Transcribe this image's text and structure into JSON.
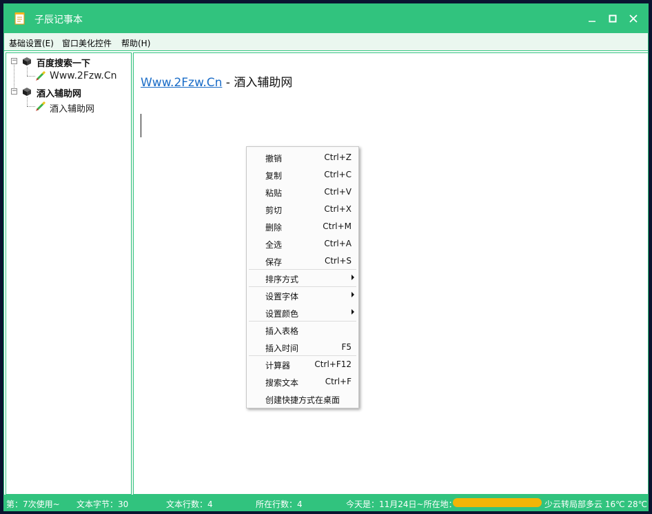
{
  "window": {
    "title": "子辰记事本"
  },
  "menubar": {
    "items": [
      "基础设置(E)",
      "窗口美化控件",
      "帮助(H)"
    ]
  },
  "tree": {
    "nodes": [
      {
        "label": "百度搜索一下",
        "child": "Www.2Fzw.Cn"
      },
      {
        "label": "酒入辅助网",
        "child": "酒入辅助网"
      }
    ]
  },
  "editor": {
    "link_text": "Www.2Fzw.Cn",
    "separator": " - ",
    "suffix": "酒入辅助网"
  },
  "context_menu": {
    "items": [
      {
        "label": "撤销",
        "shortcut": "Ctrl+Z"
      },
      {
        "label": "复制",
        "shortcut": "Ctrl+C"
      },
      {
        "label": "粘贴",
        "shortcut": "Ctrl+V"
      },
      {
        "label": "剪切",
        "shortcut": "Ctrl+X"
      },
      {
        "label": "删除",
        "shortcut": "Ctrl+M"
      },
      {
        "label": "全选",
        "shortcut": "Ctrl+A"
      },
      {
        "label": "保存",
        "shortcut": "Ctrl+S"
      },
      {
        "label": "排序方式",
        "shortcut": ""
      },
      {
        "label": "设置字体",
        "shortcut": ""
      },
      {
        "label": "设置颜色",
        "shortcut": ""
      },
      {
        "label": "插入表格",
        "shortcut": ""
      },
      {
        "label": "插入时间",
        "shortcut": "F5"
      },
      {
        "label": "计算器",
        "shortcut": "Ctrl+F12"
      },
      {
        "label": "搜索文本",
        "shortcut": "Ctrl+F"
      },
      {
        "label": "创建快捷方式在桌面",
        "shortcut": ""
      }
    ]
  },
  "statusbar": {
    "usage": "第：7次使用~",
    "bytes": "文本字节：30",
    "lines": "文本行数：4",
    "current_line": "所在行数：4",
    "today": "今天是：11月24日~所在地：",
    "weather": "少云转局部多云 16℃ 28℃"
  },
  "colors": {
    "accent": "#31c37e",
    "menubar_bg": "#eaf7ef",
    "link": "#1a6cc7",
    "location_pill": "#f2b507"
  }
}
